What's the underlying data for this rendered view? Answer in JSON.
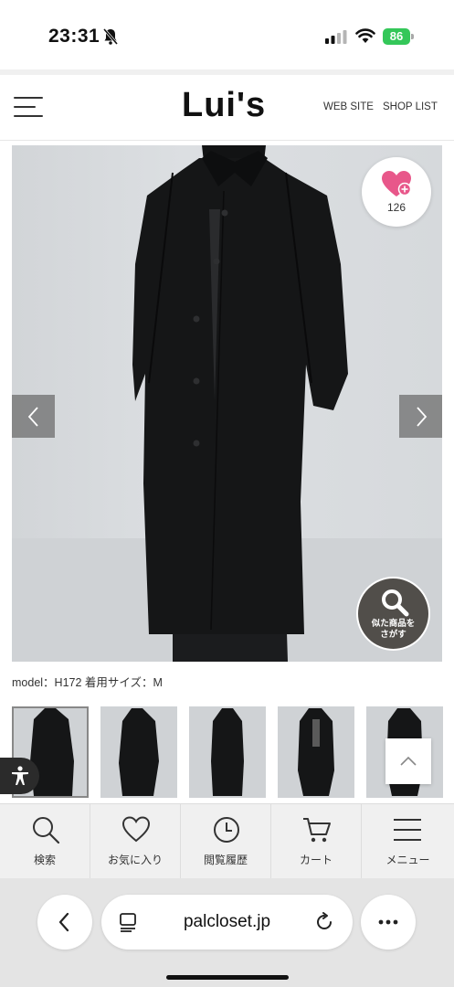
{
  "status_bar": {
    "time": "23:31",
    "battery": "86",
    "icons": [
      "bell-muted-icon",
      "cellular-signal-icon",
      "wifi-icon",
      "battery-icon"
    ]
  },
  "header": {
    "logo": "Lui's",
    "links": [
      "WEB SITE",
      "SHOP LIST"
    ],
    "menu_icon": "hamburger-icon"
  },
  "product": {
    "favorite_count": "126",
    "similar_label": "似た商品を\nさがす",
    "model_caption": "model：H172 着用サイズ：M",
    "thumbnail_count": 5,
    "active_thumbnail": 0
  },
  "bottom_nav": {
    "items": [
      {
        "label": "検索",
        "icon": "search-icon"
      },
      {
        "label": "お気に入り",
        "icon": "heart-icon"
      },
      {
        "label": "閲覧履歴",
        "icon": "clock-icon"
      },
      {
        "label": "カート",
        "icon": "cart-icon"
      },
      {
        "label": "メニュー",
        "icon": "menu-icon"
      }
    ]
  },
  "browser": {
    "url": "palcloset.jp"
  },
  "colors": {
    "favorite": "#e8578a",
    "battery": "#34c759",
    "coat": "#151617"
  }
}
